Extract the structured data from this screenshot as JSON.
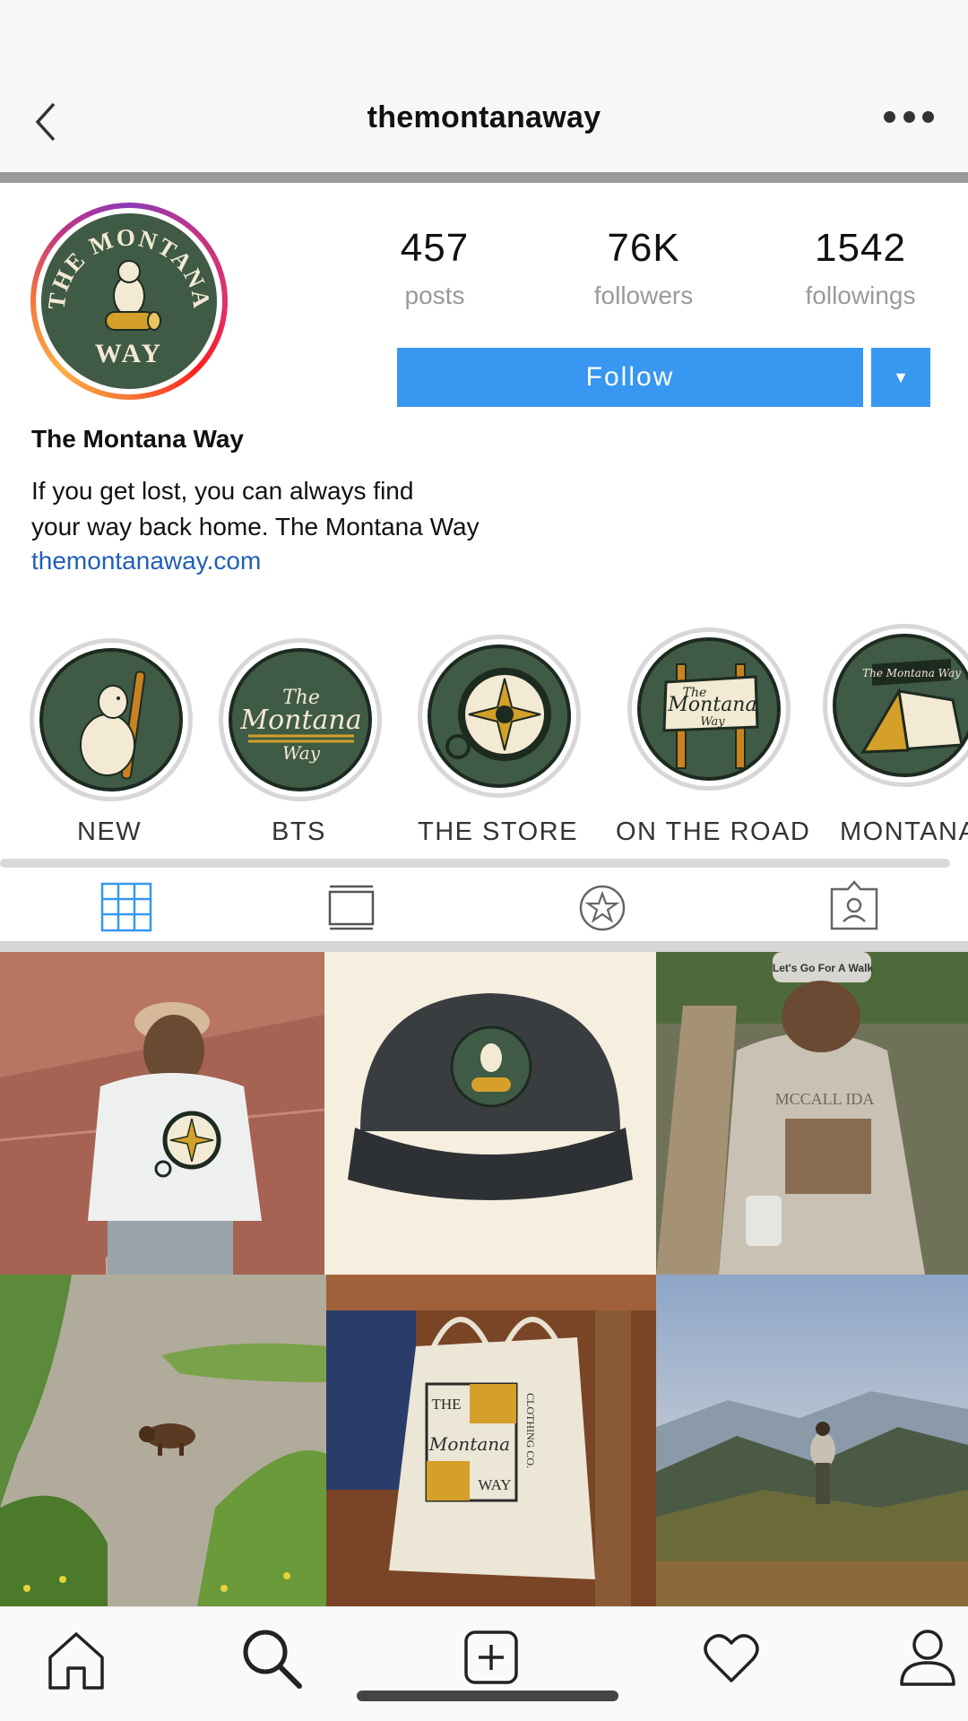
{
  "header": {
    "title": "themontanaway"
  },
  "profile": {
    "avatar_text_top": "THE MONTANA",
    "avatar_text_bottom": "WAY",
    "stats": [
      {
        "value": "457",
        "label": "posts"
      },
      {
        "value": "76K",
        "label": "followers"
      },
      {
        "value": "1542",
        "label": "followings"
      }
    ],
    "follow_label": "Follow",
    "dropdown_label": "▼",
    "name": "The Montana Way",
    "bio_line1": "If you get lost, you can always find",
    "bio_line2": "your way back home. The Montana Way",
    "link": "themontanaway.com"
  },
  "highlights": [
    {
      "label": "NEW"
    },
    {
      "label": "BTS",
      "art_text_1": "The",
      "art_text_2": "Montana",
      "art_text_3": "Way"
    },
    {
      "label": "THE STORE"
    },
    {
      "label": "ON THE ROAD",
      "art_text_1": "The",
      "art_text_2": "Montana",
      "art_text_3": "Way"
    },
    {
      "label": "MONTANA",
      "art_text_1": "The Montana Way"
    }
  ],
  "tabs": [
    "grid-icon",
    "feed-icon",
    "star-icon",
    "tagged-icon"
  ],
  "posts": [
    {
      "desc": "sweatshirt-back"
    },
    {
      "desc": "cap"
    },
    {
      "desc": "hiker-mug",
      "hat_text": "Let's Go For A Walk",
      "shirt_text": "MCCALL IDA"
    },
    {
      "desc": "bear"
    },
    {
      "desc": "tote-bag",
      "tote_l1": "THE",
      "tote_l2": "Montana",
      "tote_l3": "WAY",
      "tote_side": "CLOTHING CO."
    },
    {
      "desc": "mountain-hiker"
    }
  ],
  "nav": [
    "home-icon",
    "search-icon",
    "add-icon",
    "heart-icon",
    "profile-icon"
  ],
  "colors": {
    "accent": "#3897f0",
    "link": "#1f5fb8",
    "brand_green": "#3f5a45",
    "brand_gold": "#d4a02a"
  }
}
